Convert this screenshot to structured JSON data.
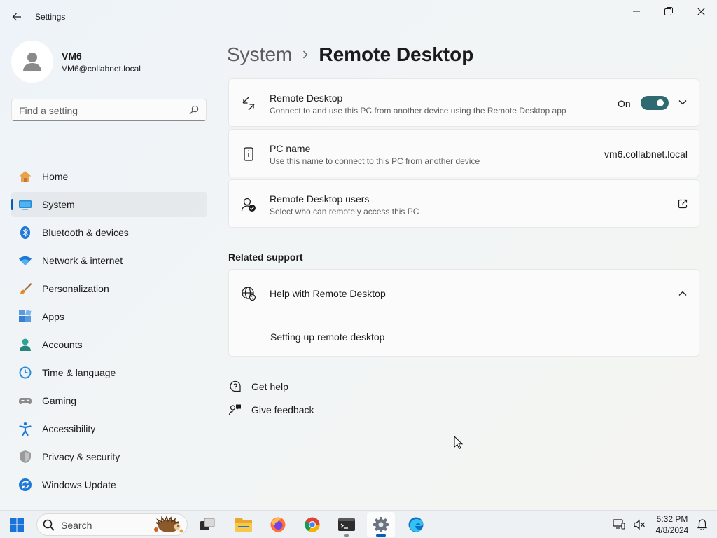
{
  "window": {
    "title": "Settings",
    "controls": [
      "minimize-icon",
      "maximize-icon",
      "close-icon"
    ]
  },
  "profile": {
    "name": "VM6",
    "email": "VM6@collabnet.local"
  },
  "search": {
    "placeholder": "Find a setting"
  },
  "sidebar": {
    "items": [
      {
        "label": "Home",
        "icon": "home-icon",
        "selected": false
      },
      {
        "label": "System",
        "icon": "system-icon",
        "selected": true
      },
      {
        "label": "Bluetooth & devices",
        "icon": "bluetooth-icon",
        "selected": false
      },
      {
        "label": "Network & internet",
        "icon": "wifi-icon",
        "selected": false
      },
      {
        "label": "Personalization",
        "icon": "brush-icon",
        "selected": false
      },
      {
        "label": "Apps",
        "icon": "apps-icon",
        "selected": false
      },
      {
        "label": "Accounts",
        "icon": "accounts-icon",
        "selected": false
      },
      {
        "label": "Time & language",
        "icon": "clock-globe-icon",
        "selected": false
      },
      {
        "label": "Gaming",
        "icon": "gamepad-icon",
        "selected": false
      },
      {
        "label": "Accessibility",
        "icon": "accessibility-icon",
        "selected": false
      },
      {
        "label": "Privacy & security",
        "icon": "shield-icon",
        "selected": false
      },
      {
        "label": "Windows Update",
        "icon": "update-icon",
        "selected": false
      }
    ]
  },
  "breadcrumb": {
    "parent": "System",
    "current": "Remote Desktop"
  },
  "cards": {
    "remote_desktop": {
      "title": "Remote Desktop",
      "subtitle": "Connect to and use this PC from another device using the Remote Desktop app",
      "state": "On",
      "enabled": true
    },
    "pc_name": {
      "title": "PC name",
      "subtitle": "Use this name to connect to this PC from another device",
      "value": "vm6.collabnet.local"
    },
    "users": {
      "title": "Remote Desktop users",
      "subtitle": "Select who can remotely access this PC"
    }
  },
  "related_support": {
    "heading": "Related support",
    "help_title": "Help with Remote Desktop",
    "links": [
      "Setting up remote desktop"
    ]
  },
  "footer_links": {
    "get_help": "Get help",
    "give_feedback": "Give feedback"
  },
  "taskbar": {
    "search_placeholder": "Search",
    "apps": [
      "windows-start-icon",
      "task-view-icon",
      "file-explorer-icon",
      "firefox-icon",
      "chrome-icon",
      "terminal-icon",
      "settings-icon",
      "edge-icon"
    ],
    "time": "5:32 PM",
    "date": "4/8/2024"
  },
  "colors": {
    "accent": "#005fb8",
    "toggle_on": "#2f6a70"
  }
}
